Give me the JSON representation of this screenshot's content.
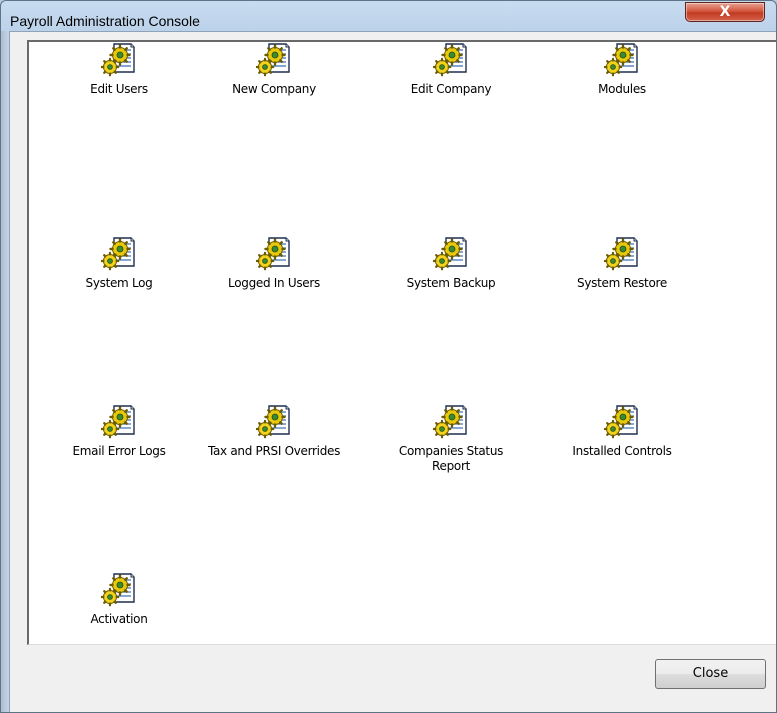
{
  "window": {
    "title": "Payroll Administration Console",
    "close_glyph": "X"
  },
  "items": [
    {
      "label": "Edit Users",
      "icon": "document-gears-icon"
    },
    {
      "label": "New Company",
      "icon": "document-gears-icon"
    },
    {
      "label": "Edit Company",
      "icon": "document-gears-icon"
    },
    {
      "label": "Modules",
      "icon": "document-gears-icon"
    },
    {
      "label": "System Log",
      "icon": "document-gears-icon"
    },
    {
      "label": "Logged In Users",
      "icon": "document-gears-icon"
    },
    {
      "label": "System Backup",
      "icon": "document-gears-icon"
    },
    {
      "label": "System Restore",
      "icon": "document-gears-icon"
    },
    {
      "label": "Email Error Logs",
      "icon": "document-gears-icon"
    },
    {
      "label": "Tax and PRSI Overrides",
      "icon": "document-gears-icon"
    },
    {
      "label": "Companies Status Report",
      "icon": "document-gears-icon"
    },
    {
      "label": "Installed Controls",
      "icon": "document-gears-icon"
    },
    {
      "label": "Activation",
      "icon": "document-gears-icon"
    }
  ],
  "footer": {
    "close_label": "Close"
  },
  "colors": {
    "title_close_red": "#c23a22",
    "gear_yellow": "#e8c80a",
    "gear_green": "#3c8a2e"
  }
}
